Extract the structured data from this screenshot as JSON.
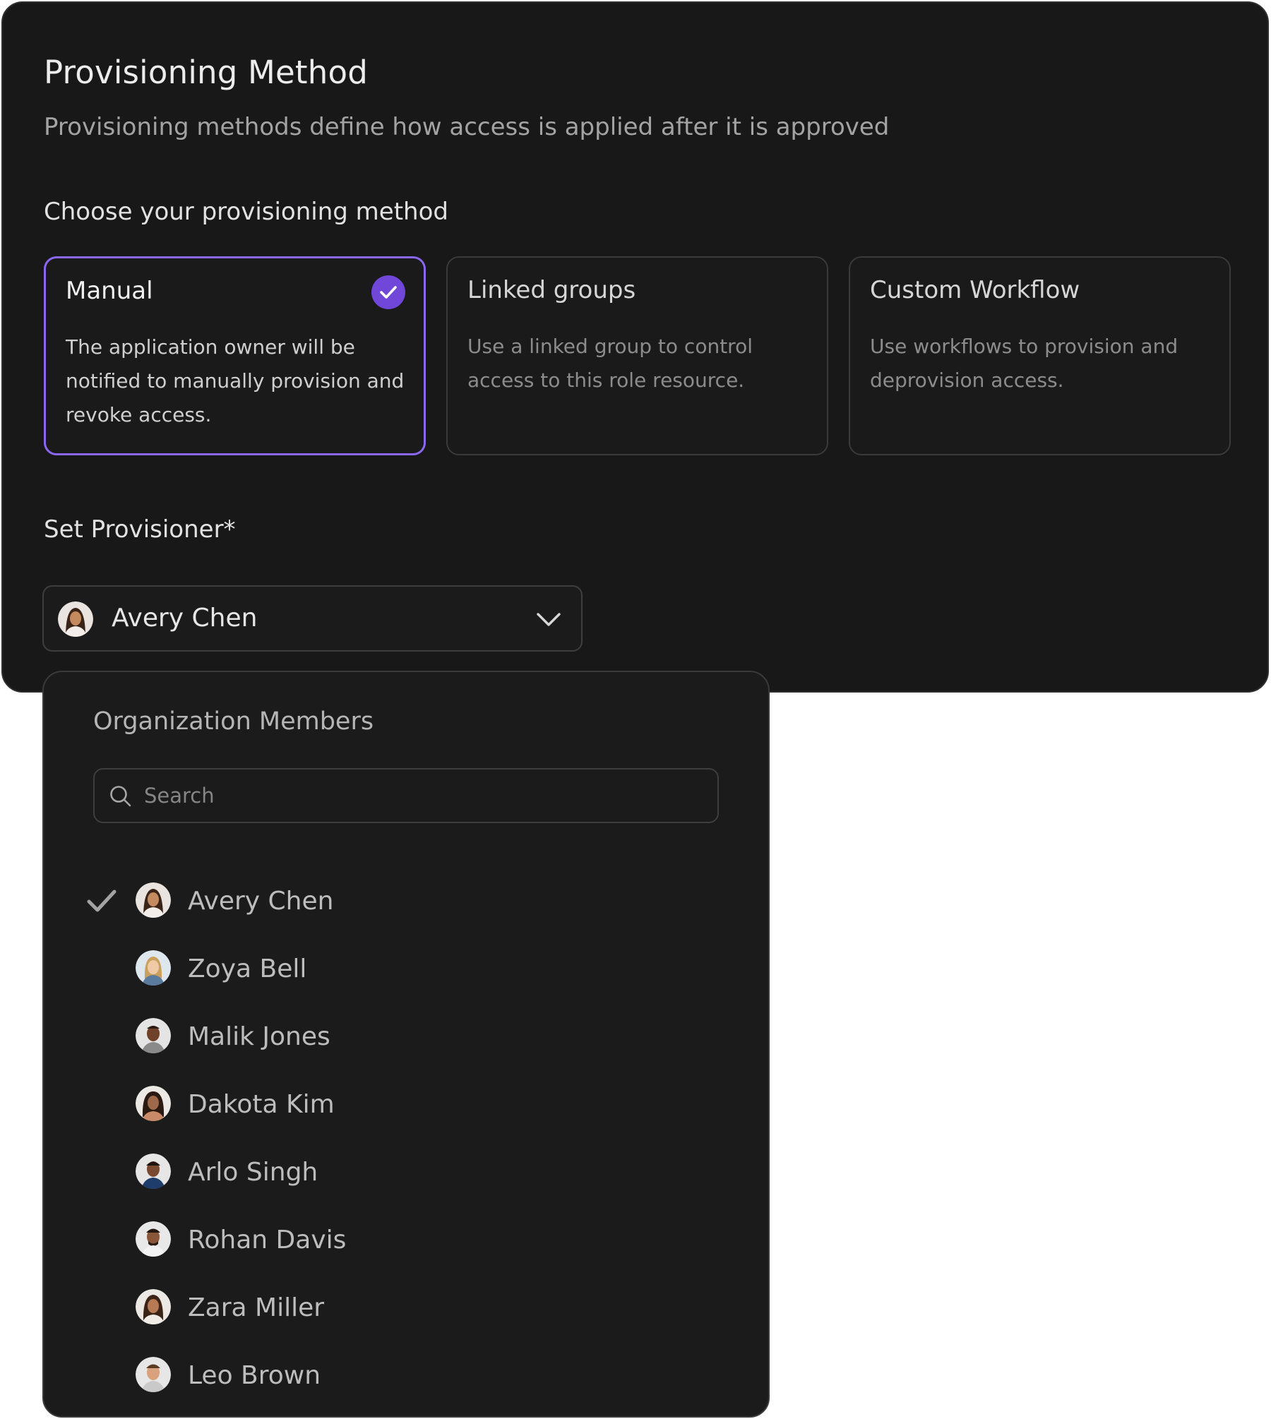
{
  "header": {
    "title": "Provisioning Method",
    "subtitle": "Provisioning methods define how access is applied after it is approved"
  },
  "method_section": {
    "label": "Choose your provisioning method",
    "options": [
      {
        "title": "Manual",
        "description": "The application owner will be notified to manually provision and revoke access.",
        "selected": true
      },
      {
        "title": "Linked groups",
        "description": "Use a linked group to control access to this role resource.",
        "selected": false
      },
      {
        "title": "Custom Workflow",
        "description": "Use workflows to provision and deprovision access.",
        "selected": false
      }
    ]
  },
  "provisioner": {
    "label": "Set Provisioner*",
    "selected_value": "Avery Chen"
  },
  "dropdown": {
    "title": "Organization Members",
    "search_placeholder": "Search",
    "members": [
      {
        "name": "Avery Chen",
        "selected": true
      },
      {
        "name": "Zoya Bell",
        "selected": false
      },
      {
        "name": "Malik Jones",
        "selected": false
      },
      {
        "name": "Dakota Kim",
        "selected": false
      },
      {
        "name": "Arlo Singh",
        "selected": false
      },
      {
        "name": "Rohan Davis",
        "selected": false
      },
      {
        "name": "Zara Miller",
        "selected": false
      },
      {
        "name": "Leo Brown",
        "selected": false
      }
    ]
  },
  "colors": {
    "panel_background": "#181818",
    "accent": "#7047d8",
    "selected_border": "#8b66f0"
  }
}
